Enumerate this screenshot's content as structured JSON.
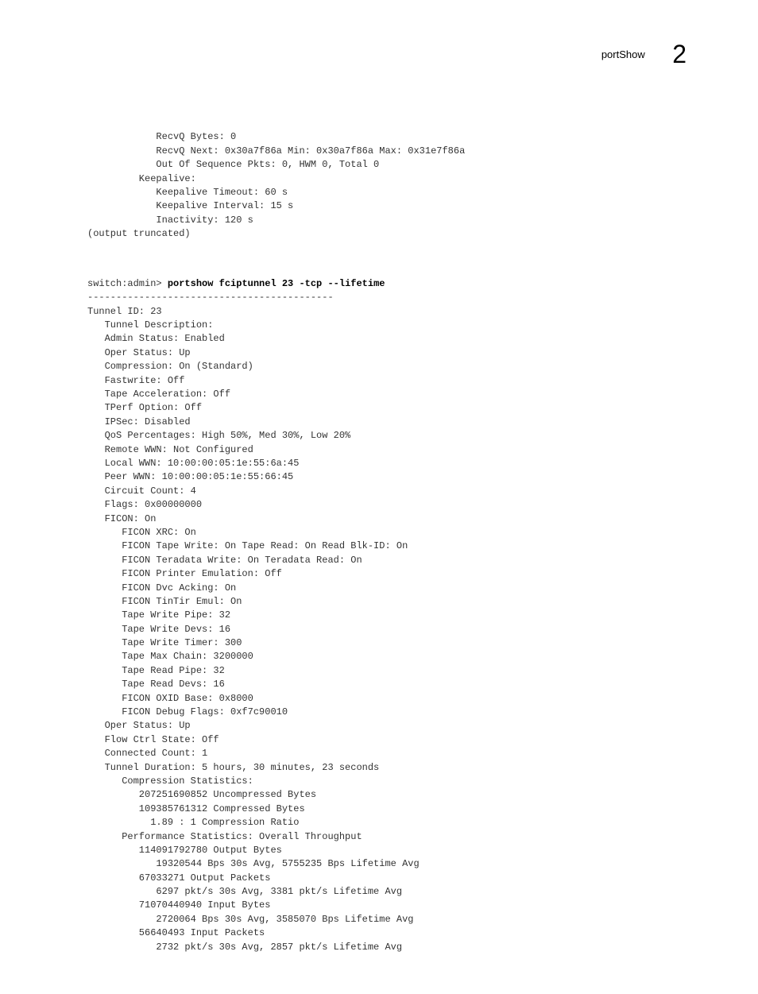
{
  "header": {
    "title": "portShow",
    "chapter": "2"
  },
  "block1": {
    "l1": "            RecvQ Bytes: 0",
    "l2": "            RecvQ Next: 0x30a7f86a Min: 0x30a7f86a Max: 0x31e7f86a",
    "l3": "            Out Of Sequence Pkts: 0, HWM 0, Total 0",
    "l4": "         Keepalive:",
    "l5": "            Keepalive Timeout: 60 s",
    "l6": "            Keepalive Interval: 15 s",
    "l7": "            Inactivity: 120 s",
    "l8": "(output truncated)"
  },
  "block2": {
    "prompt": "switch:admin> ",
    "command": "portshow fciptunnel 23 -tcp --lifetime",
    "l1": "-------------------------------------------",
    "l2": "Tunnel ID: 23",
    "l3": "   Tunnel Description:",
    "l4": "   Admin Status: Enabled",
    "l5": "   Oper Status: Up",
    "l6": "   Compression: On (Standard)",
    "l7": "   Fastwrite: Off",
    "l8": "   Tape Acceleration: Off",
    "l9": "   TPerf Option: Off",
    "l10": "   IPSec: Disabled",
    "l11": "   QoS Percentages: High 50%, Med 30%, Low 20%",
    "l12": "   Remote WWN: Not Configured",
    "l13": "   Local WWN: 10:00:00:05:1e:55:6a:45",
    "l14": "   Peer WWN: 10:00:00:05:1e:55:66:45",
    "l15": "   Circuit Count: 4",
    "l16": "   Flags: 0x00000000",
    "l17": "   FICON: On",
    "l18": "      FICON XRC: On",
    "l19": "      FICON Tape Write: On Tape Read: On Read Blk-ID: On",
    "l20": "      FICON Teradata Write: On Teradata Read: On",
    "l21": "      FICON Printer Emulation: Off",
    "l22": "      FICON Dvc Acking: On",
    "l23": "      FICON TinTir Emul: On",
    "l24": "      Tape Write Pipe: 32",
    "l25": "      Tape Write Devs: 16",
    "l26": "      Tape Write Timer: 300",
    "l27": "      Tape Max Chain: 3200000",
    "l28": "      Tape Read Pipe: 32",
    "l29": "      Tape Read Devs: 16",
    "l30": "      FICON OXID Base: 0x8000",
    "l31": "      FICON Debug Flags: 0xf7c90010",
    "l32": "   Oper Status: Up",
    "l33": "   Flow Ctrl State: Off",
    "l34": "   Connected Count: 1",
    "l35": "   Tunnel Duration: 5 hours, 30 minutes, 23 seconds",
    "l36": "      Compression Statistics:",
    "l37": "         207251690852 Uncompressed Bytes",
    "l38": "         109385761312 Compressed Bytes",
    "l39": "           1.89 : 1 Compression Ratio",
    "l40": "      Performance Statistics: Overall Throughput",
    "l41": "         114091792780 Output Bytes",
    "l42": "            19320544 Bps 30s Avg, 5755235 Bps Lifetime Avg",
    "l43": "         67033271 Output Packets",
    "l44": "            6297 pkt/s 30s Avg, 3381 pkt/s Lifetime Avg",
    "l45": "         71070440940 Input Bytes",
    "l46": "            2720064 Bps 30s Avg, 3585070 Bps Lifetime Avg",
    "l47": "         56640493 Input Packets",
    "l48": "            2732 pkt/s 30s Avg, 2857 pkt/s Lifetime Avg"
  }
}
